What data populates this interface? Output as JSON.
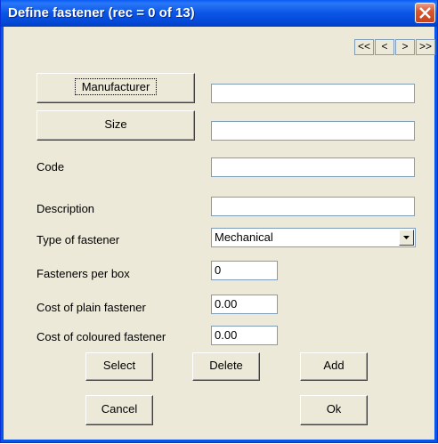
{
  "window": {
    "title": "Define fastener (rec = 0 of 13)"
  },
  "nav": {
    "first": "<<",
    "prev": "<",
    "next": ">",
    "last": ">>"
  },
  "form": {
    "manufacturer_button": "Manufacturer",
    "manufacturer_value": "",
    "size_button": "Size",
    "size_value": "",
    "code_label": "Code",
    "code_value": "",
    "description_label": "Description",
    "description_value": "",
    "type_label": "Type of fastener",
    "type_value": "Mechanical",
    "per_box_label": "Fasteners per box",
    "per_box_value": "0",
    "plain_cost_label": "Cost of plain fastener",
    "plain_cost_value": "0.00",
    "coloured_cost_label": "Cost of coloured fastener",
    "coloured_cost_value": "0.00"
  },
  "buttons": {
    "select": "Select",
    "delete": "Delete",
    "add": "Add",
    "cancel": "Cancel",
    "ok": "Ok"
  }
}
